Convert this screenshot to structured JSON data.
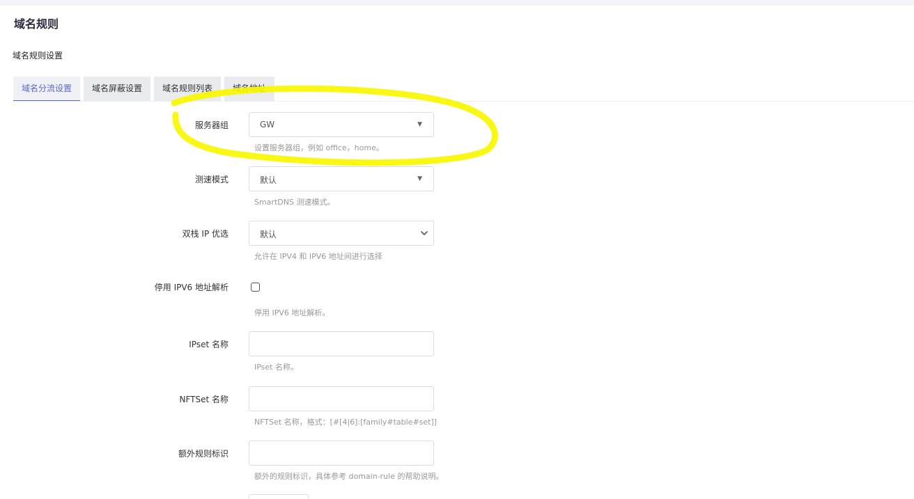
{
  "page": {
    "title": "域名规则",
    "section_title": "域名规则设置"
  },
  "tabs": [
    {
      "label": "域名分流设置",
      "active": true
    },
    {
      "label": "域名屏蔽设置",
      "active": false
    },
    {
      "label": "域名规则列表",
      "active": false
    },
    {
      "label": "域名地址",
      "active": false
    }
  ],
  "form": {
    "server_group": {
      "label": "服务器组",
      "value": "GW",
      "hint": "设置服务器组，例如 office，home。"
    },
    "speed_mode": {
      "label": "测速模式",
      "value": "默认",
      "hint": "SmartDNS 测速模式。"
    },
    "dualstack": {
      "label": "双栈 IP 优选",
      "value": "默认",
      "hint": "允许在 IPV4 和 IPV6 地址间进行选择"
    },
    "disable_ipv6": {
      "label": "停用 IPV6 地址解析",
      "checked": false,
      "hint": "停用 IPV6 地址解析。"
    },
    "ipset": {
      "label": "IPset 名称",
      "value": "",
      "hint": "IPset 名称。"
    },
    "nftset": {
      "label": "NFTSet 名称",
      "value": "",
      "hint": "NFTSet 名称，格式：[#[4|6]:[family#table#set]]"
    },
    "extra_rule": {
      "label": "额外规则标识",
      "value": "",
      "hint": "额外的规则标识，具体参考 domain-rule 的帮助说明。"
    }
  },
  "colors": {
    "accent": "#5b67c9",
    "highlight": "#f7f700"
  },
  "icons": {
    "select_caret": "caret-down-icon",
    "native_select": "chevron-down-icon"
  }
}
